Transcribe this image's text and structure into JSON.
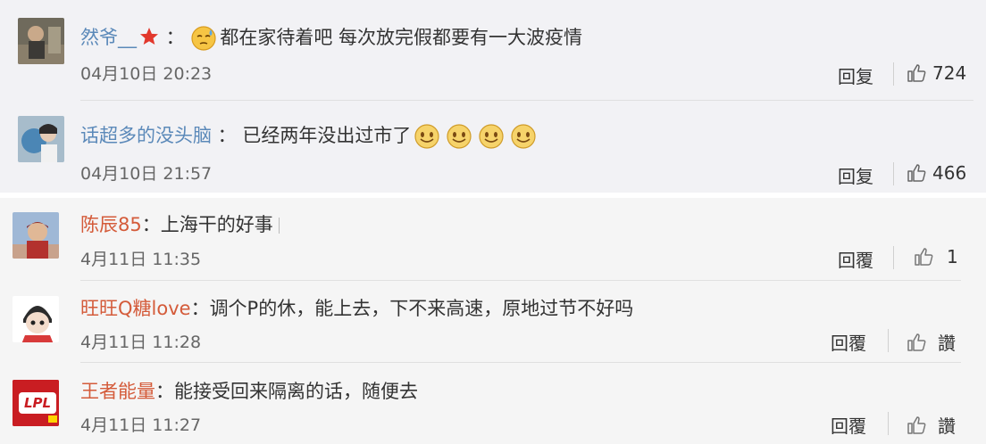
{
  "comments": [
    {
      "user": "然爷__",
      "text": "都在家待着吧 每次放完假都要有一大波疫情",
      "time": "04月10日 20:23",
      "reply": "回复",
      "likes": "724"
    },
    {
      "user": "话超多的没头脑",
      "text": "已经两年没出过市了",
      "time": "04月10日 21:57",
      "reply": "回复",
      "likes": "466"
    },
    {
      "user": "陈辰85",
      "text": "上海干的好事",
      "time": "4月11日 11:35",
      "reply": "回覆",
      "likes": "1"
    },
    {
      "user": "旺旺Q糖love",
      "text": "调个P的休，能上去，下不来高速，原地过节不好吗",
      "time": "4月11日 11:28",
      "reply": "回覆",
      "likes": "讚"
    },
    {
      "user": "王者能量",
      "text": "能接受回来隔离的话，随便去",
      "time": "4月11日 11:27",
      "reply": "回覆",
      "likes": "讚"
    }
  ],
  "avatar_logo_text": "LPL",
  "colors": {
    "name_blue": "#5b89b9",
    "name_orange": "#d45b3a",
    "panel_top": "#f2f2f5",
    "panel_bottom": "#f5f5f5"
  }
}
